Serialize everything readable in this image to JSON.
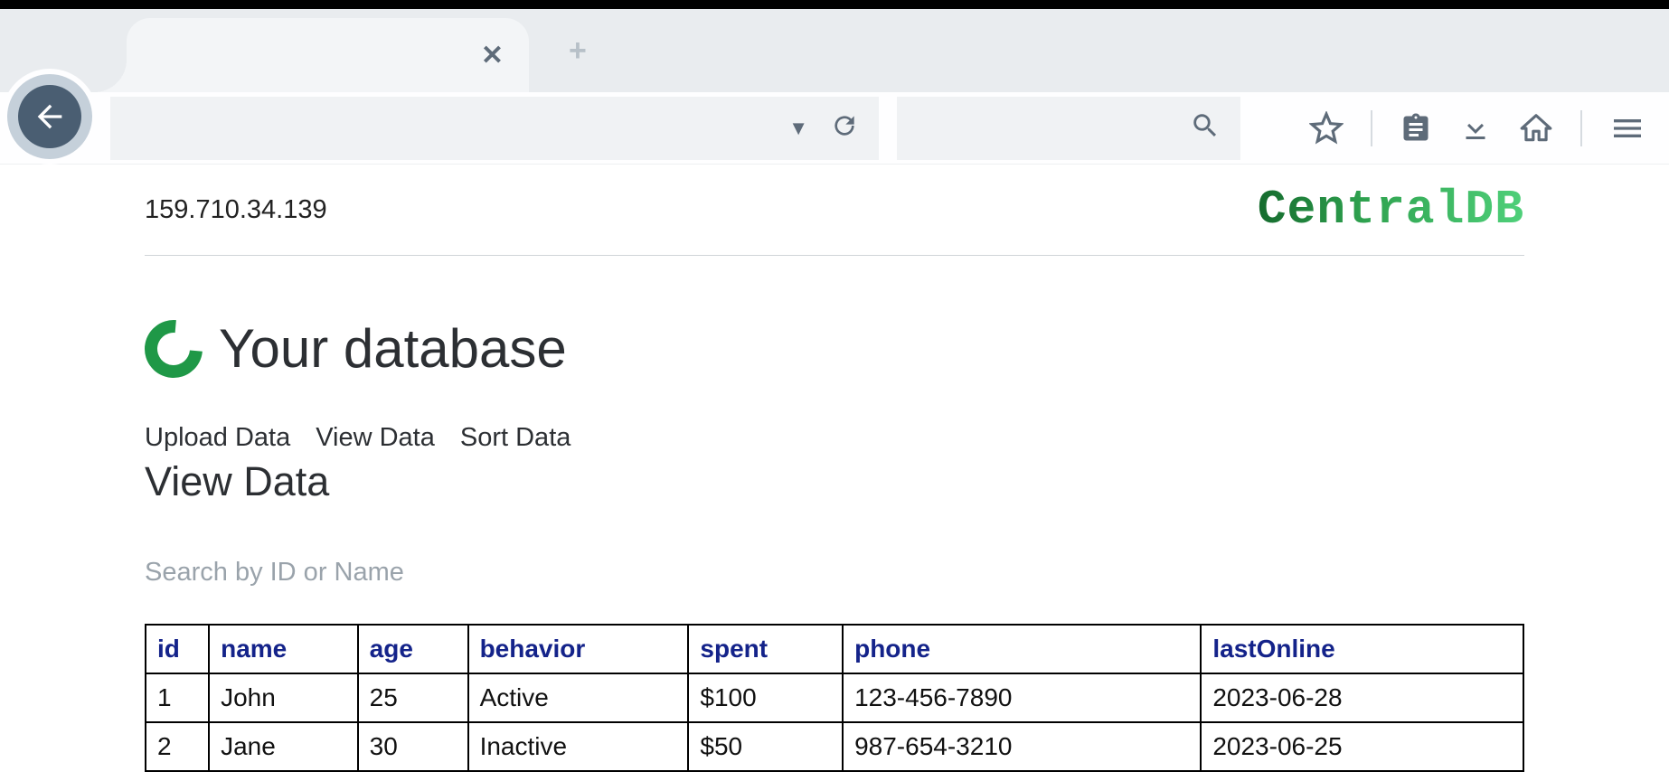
{
  "header": {
    "ip": "159.710.34.139",
    "brand": "CentralDB"
  },
  "section": {
    "title": "Your database",
    "tabs": [
      {
        "label": "Upload Data"
      },
      {
        "label": "View Data"
      },
      {
        "label": "Sort Data"
      }
    ],
    "heading": "View Data",
    "search_placeholder": "Search by ID or Name"
  },
  "table": {
    "columns": [
      "id",
      "name",
      "age",
      "behavior",
      "spent",
      "phone",
      "lastOnline"
    ],
    "rows": [
      {
        "id": "1",
        "name": "John",
        "age": "25",
        "behavior": "Active",
        "spent": "$100",
        "phone": "123-456-7890",
        "lastOnline": "2023-06-28"
      },
      {
        "id": "2",
        "name": "Jane",
        "age": "30",
        "behavior": "Inactive",
        "spent": "$50",
        "phone": "987-654-3210",
        "lastOnline": "2023-06-25"
      }
    ]
  }
}
